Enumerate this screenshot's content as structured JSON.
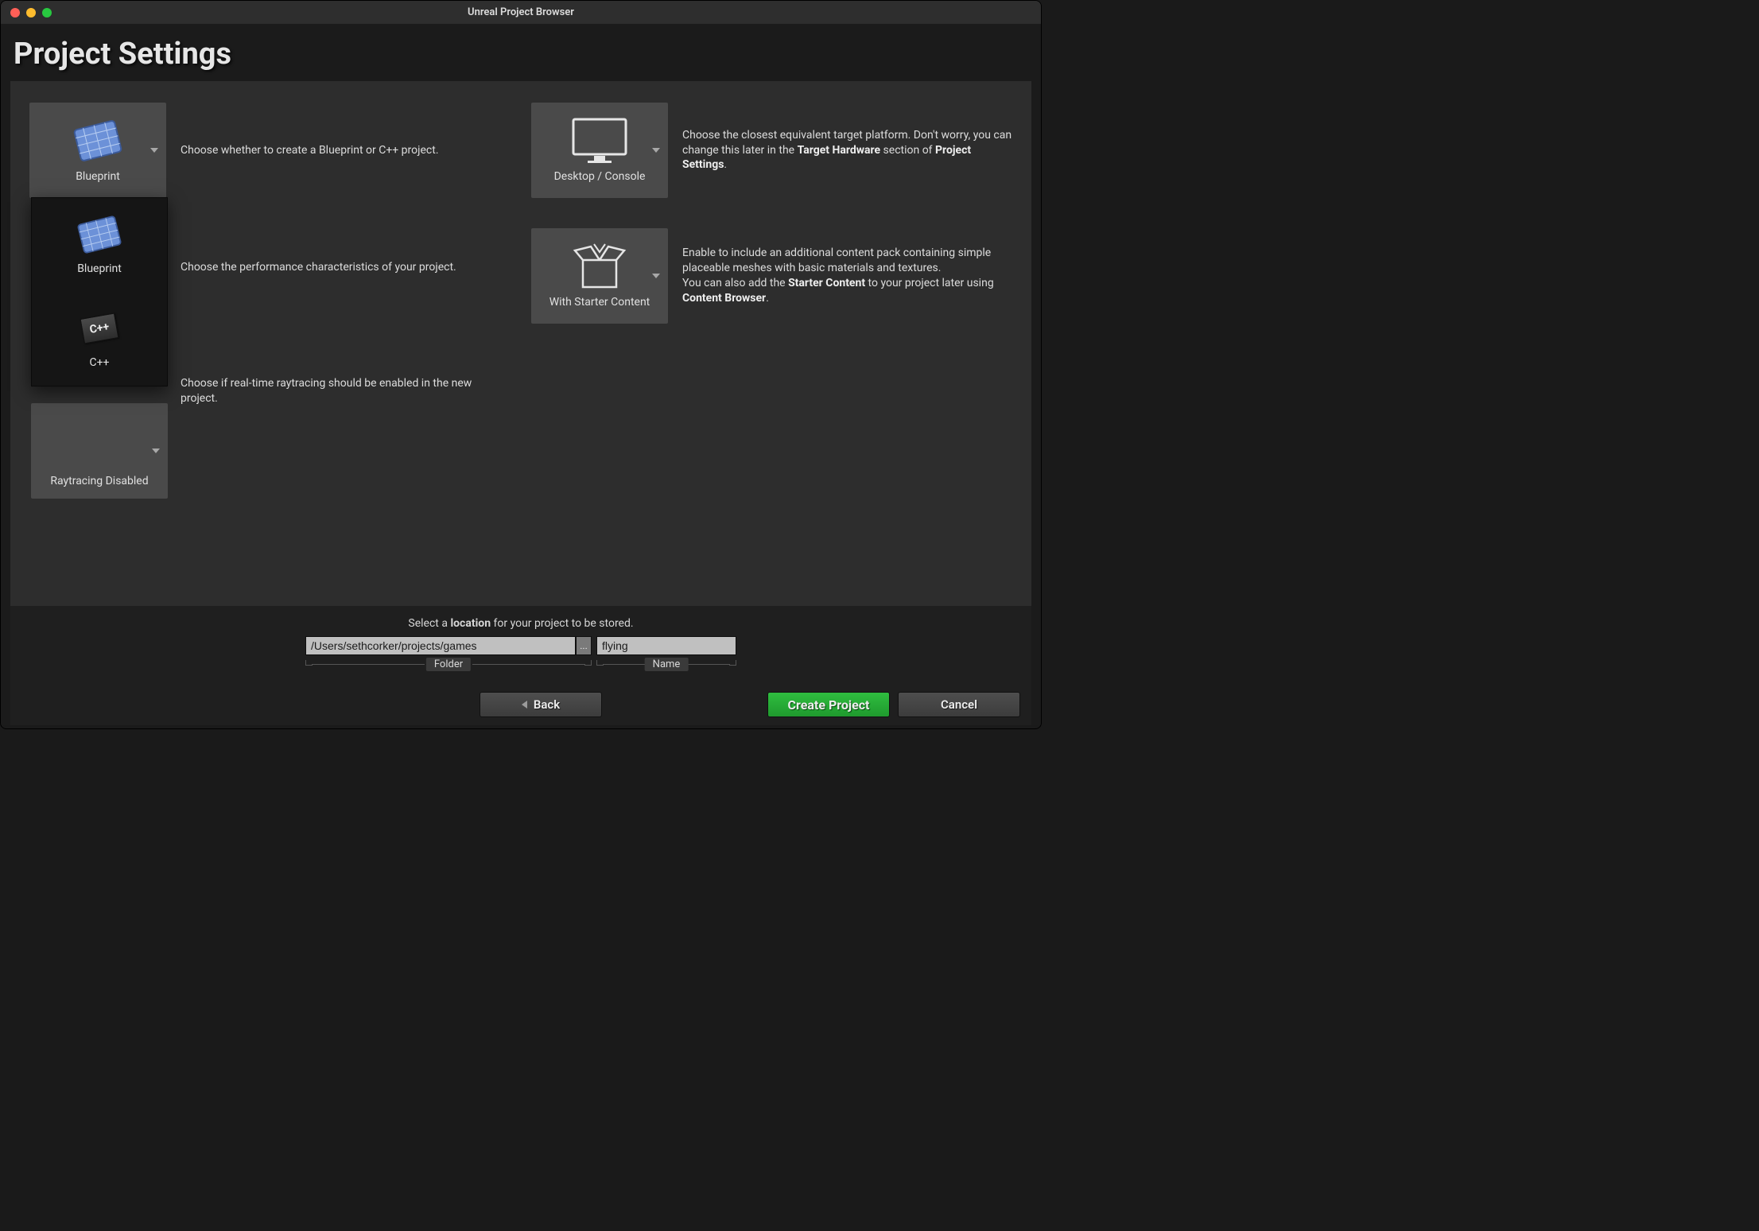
{
  "window": {
    "title": "Unreal Project Browser"
  },
  "header": "Project Settings",
  "left": {
    "blueprint": {
      "selected_label": "Blueprint",
      "description": "Choose whether to create a Blueprint or C++ project.",
      "options": {
        "blueprint": "Blueprint",
        "cpp": "C++"
      }
    },
    "performance": {
      "description": "Choose the performance characteristics of your project."
    },
    "raytracing": {
      "selected_label": "Raytracing Disabled",
      "description": "Choose if real-time raytracing should be enabled in the new project."
    }
  },
  "right": {
    "platform": {
      "selected_label": "Desktop / Console",
      "description_pre": "Choose the closest equivalent target platform. Don't worry, you can change this later in the ",
      "strong1": "Target Hardware",
      "mid": " section of ",
      "strong2": "Project Settings",
      "post": "."
    },
    "starter": {
      "selected_label": "With Starter Content",
      "line1": "Enable to include an additional content pack containing simple placeable meshes with basic materials and textures.",
      "line2_pre": "You can also add the ",
      "strong1": "Starter Content",
      "line2_mid": " to your project later using ",
      "strong2": "Content Browser",
      "line2_post": "."
    }
  },
  "footer": {
    "hint_pre": "Select a ",
    "hint_strong": "location",
    "hint_post": " for your project to be stored.",
    "folder_value": "/Users/sethcorker/projects/games",
    "folder_label": "Folder",
    "browse_label": "...",
    "name_value": "flying",
    "name_label": "Name"
  },
  "buttons": {
    "back": "Back",
    "create": "Create Project",
    "cancel": "Cancel"
  }
}
